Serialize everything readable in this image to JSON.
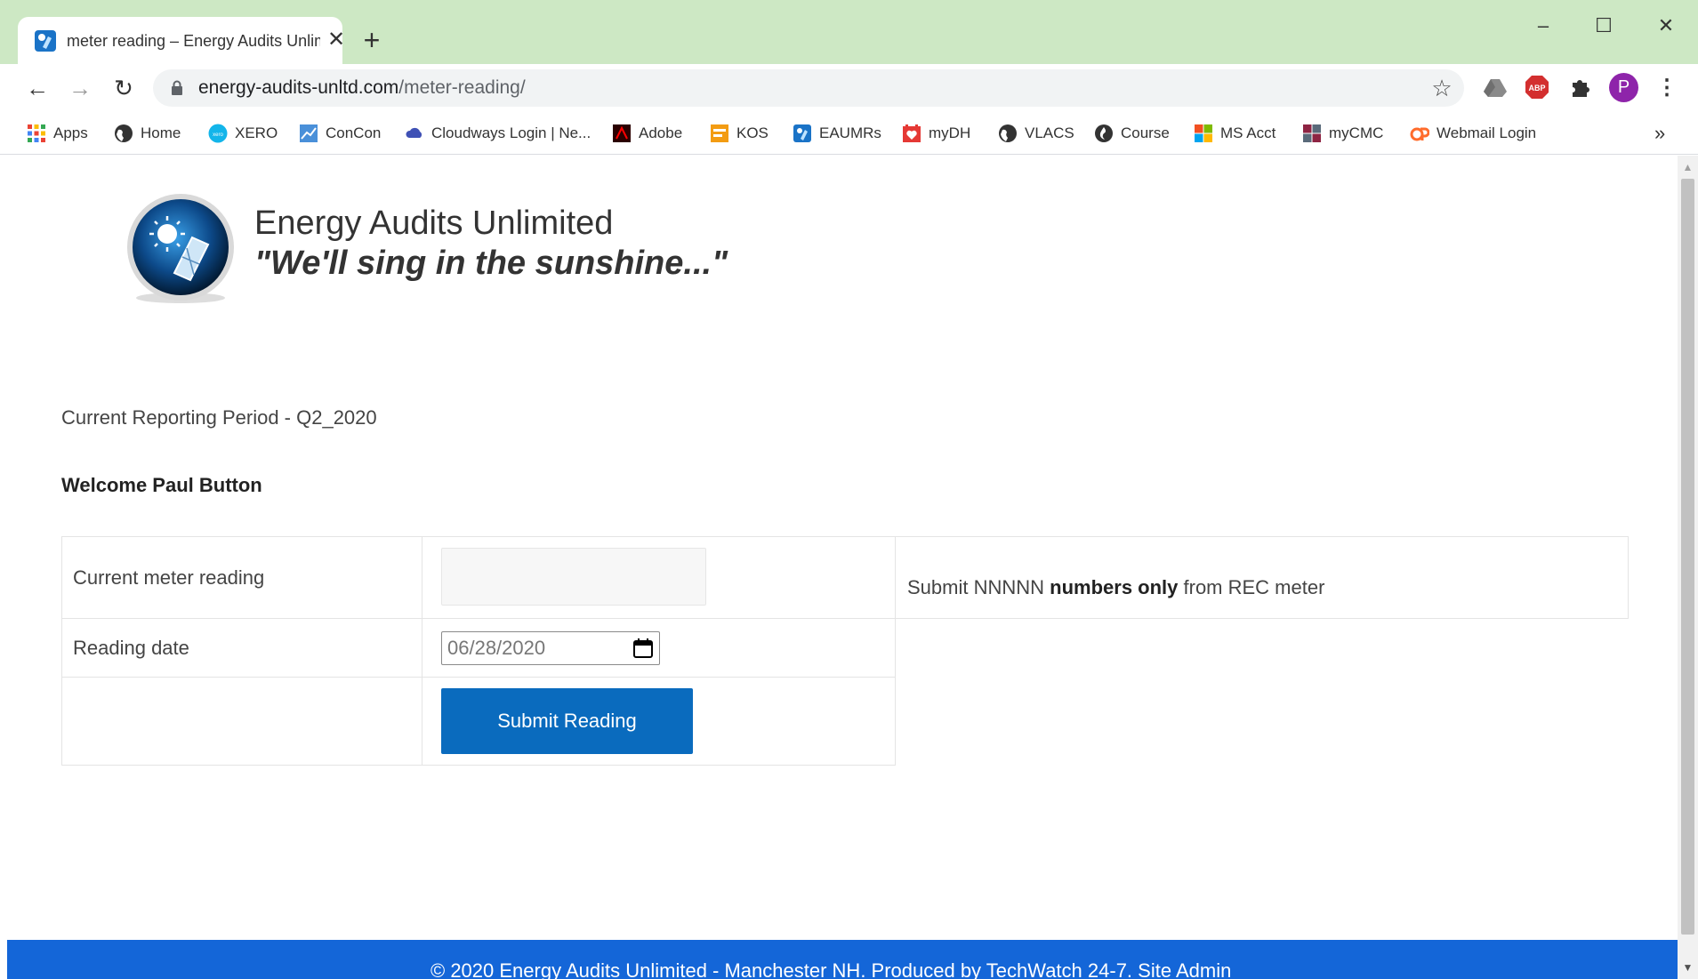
{
  "browser": {
    "tab": {
      "title": "meter reading – Energy Audits Unlim",
      "close_glyph": "✕"
    },
    "new_tab_glyph": "+",
    "window_controls": {
      "minimize": "–",
      "maximize": "☐",
      "close": "✕"
    },
    "nav": {
      "back": "←",
      "forward": "→",
      "reload": "↻"
    },
    "url": {
      "host": "energy-audits-unltd.com",
      "path": "/meter-reading/"
    },
    "star_glyph": "☆",
    "menu_glyph": "⋮",
    "profile_initial": "P",
    "extension_abp": "ABP",
    "bookmarks": [
      {
        "label": "Apps",
        "icon": "apps-grid-icon",
        "color": "#ea4335"
      },
      {
        "label": "Home",
        "icon": "globe-icon",
        "color": "#333333"
      },
      {
        "label": "XERO",
        "icon": "xero-icon",
        "color": "#13b5ea"
      },
      {
        "label": "ConCon",
        "icon": "concon-icon",
        "color": "#4a90d9"
      },
      {
        "label": "Cloudways Login | Ne...",
        "icon": "cloud-icon",
        "color": "#3f51b5"
      },
      {
        "label": "Adobe",
        "icon": "adobe-icon",
        "color": "#b30b00"
      },
      {
        "label": "KOS",
        "icon": "kos-icon",
        "color": "#f39c12"
      },
      {
        "label": "EAUMRs",
        "icon": "eau-icon",
        "color": "#1a73c7"
      },
      {
        "label": "myDH",
        "icon": "mydh-icon",
        "color": "#e53935"
      },
      {
        "label": "VLACS",
        "icon": "globe-icon",
        "color": "#333333"
      },
      {
        "label": "Course",
        "icon": "course-icon",
        "color": "#333333"
      },
      {
        "label": "MS Acct",
        "icon": "microsoft-icon",
        "color": "#f25022"
      },
      {
        "label": "myCMC",
        "icon": "mycmc-icon",
        "color": "#8e2443"
      },
      {
        "label": "Webmail Login",
        "icon": "webmail-icon",
        "color": "#ff6c2c"
      }
    ],
    "bookmarks_more": "»"
  },
  "page": {
    "site_title": "Energy Audits Unlimited",
    "tagline": "\"We'll sing in the sunshine...\"",
    "reporting_period": "Current Reporting Period - Q2_2020",
    "welcome": "Welcome Paul Button",
    "form": {
      "meter_label": "Current meter reading",
      "meter_value": "",
      "date_label": "Reading date",
      "date_value": "06/28/2020",
      "submit_label": "Submit Reading",
      "hint_prefix": "Submit NNNNN ",
      "hint_bold": "numbers only",
      "hint_suffix": " from REC meter"
    },
    "footer": "© 2020 Energy Audits Unlimited - Manchester NH. Produced by TechWatch 24-7. Site Admin"
  },
  "colors": {
    "titlebar": "#cde8c4",
    "accent_button": "#0a6bbe",
    "footer": "#1466d8"
  }
}
